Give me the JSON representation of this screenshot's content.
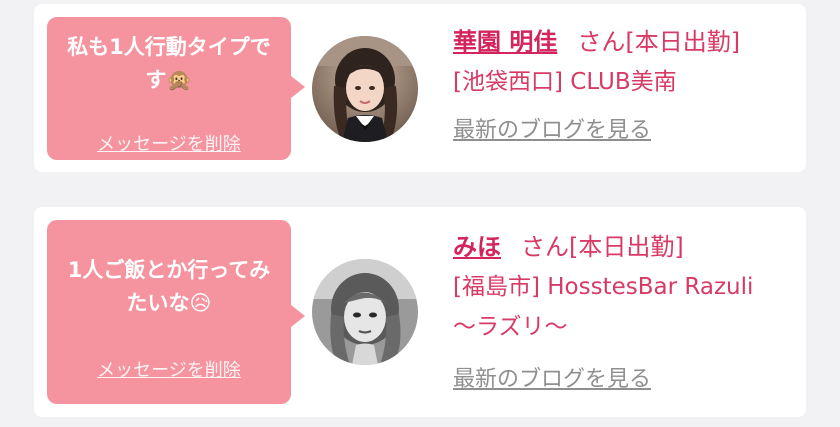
{
  "colors": {
    "background": "#f2f2f4",
    "bubble": "#f5939e",
    "accent": "#d3245c",
    "link_gray": "#8f8f8f"
  },
  "cards": [
    {
      "message_text": "私も1人行動タイプです",
      "message_emoji": "🙊",
      "delete_label": "メッセージを削除",
      "name": "華園 明佳",
      "honorific": "さん[本日出勤]",
      "shop_lines": [
        "[池袋西口] CLUB美南"
      ],
      "blog_link": "最新のブログを見る"
    },
    {
      "message_text": "1人ご飯とか行ってみたいな",
      "message_emoji": "😥",
      "delete_label": "メッセージを削除",
      "name": "みほ",
      "honorific": "さん[本日出勤]",
      "shop_lines": [
        "[福島市] HosstesBar Razuli",
        "〜ラズリ〜"
      ],
      "blog_link": "最新のブログを見る"
    }
  ]
}
